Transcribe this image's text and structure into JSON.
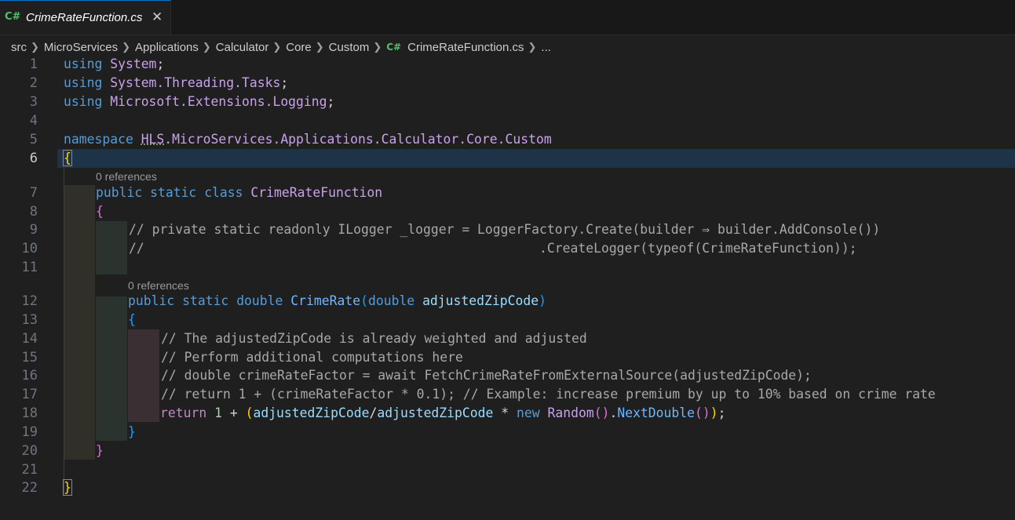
{
  "tab": {
    "icon": "csharp-file-icon",
    "icon_text": "C#",
    "label": "CrimeRateFunction.cs",
    "close_glyph": "✕"
  },
  "breadcrumb": {
    "items": [
      "src",
      "MicroServices",
      "Applications",
      "Calculator",
      "Core",
      "Custom"
    ],
    "file_icon_text": "C#",
    "file": "CrimeRateFunction.cs",
    "more": "..."
  },
  "editor": {
    "active_line": 6,
    "code_lens": [
      "0 references",
      "0 references"
    ],
    "line_numbers": [
      "1",
      "2",
      "3",
      "4",
      "5",
      "6",
      "7",
      "8",
      "9",
      "10",
      "11",
      "12",
      "13",
      "14",
      "15",
      "16",
      "17",
      "18",
      "19",
      "20",
      "21",
      "22"
    ],
    "tokens": {
      "using": "using",
      "system": "System",
      "semi": ";",
      "system_threading_tasks": "System.Threading.Tasks",
      "ms_ext_logging": "Microsoft.Extensions.Logging",
      "namespace": "namespace",
      "ns_hls": "HLS",
      "ns_rest": ".MicroServices.Applications.Calculator.Core.Custom",
      "open_brace": "{",
      "close_brace": "}",
      "public": "public",
      "static": "static",
      "class": "class",
      "class_name": "CrimeRateFunction",
      "comment_1": "// private static readonly ILogger _logger = LoggerFactory.Create(builder ⇒ builder.AddConsole())",
      "comment_2": "//                                                   .CreateLogger(typeof(CrimeRateFunction));",
      "double": "double",
      "method_name": "CrimeRate",
      "open_paren": "(",
      "close_paren": ")",
      "param_type": "double",
      "param_name": "adjustedZipCode",
      "comment_3": "// The adjustedZipCode is already weighted and adjusted",
      "comment_4": "// Perform additional computations here",
      "comment_5": "// double crimeRateFactor = await FetchCrimeRateFromExternalSource(adjustedZipCode);",
      "comment_6": "// return 1 + (crimeRateFactor * 0.1); // Example: increase premium by up to 10% based on crime rate",
      "return": "return",
      "one": "1",
      "plus": " + ",
      "var_a": "adjustedZipCode",
      "slash": "/",
      "var_b": "adjustedZipCode",
      "times": " * ",
      "new": "new",
      "random": "Random",
      "empty_parens": "()",
      "dot": ".",
      "next_double": "NextDouble"
    }
  }
}
